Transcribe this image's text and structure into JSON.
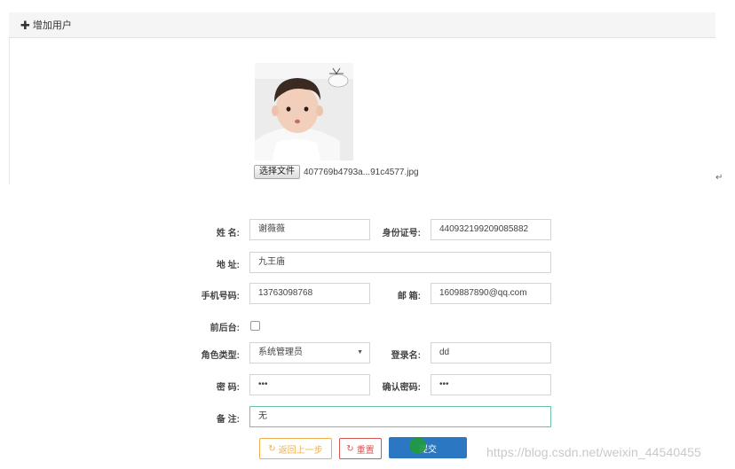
{
  "header": {
    "icon": "plus-icon",
    "title": "增加用户"
  },
  "upload": {
    "button_label": "选择文件",
    "file_name": "407769b4793a...91c4577.jpg"
  },
  "return_mark": "↵",
  "form": {
    "name": {
      "label": "姓 名:",
      "value": "谢薇薇"
    },
    "id_number": {
      "label": "身份证号:",
      "value": "440932199209085882"
    },
    "address": {
      "label": "地 址:",
      "value": "九王庙"
    },
    "phone": {
      "label": "手机号码:",
      "value": "13763098768"
    },
    "email": {
      "label": "邮 箱:",
      "value": "1609887890@qq.com"
    },
    "backend": {
      "label": "前后台:",
      "checked": false
    },
    "role": {
      "label": "角色类型:",
      "value": "系统管理员"
    },
    "login": {
      "label": "登录名:",
      "value": "dd"
    },
    "password": {
      "label": "密 码:",
      "value": "•••"
    },
    "confirm_password": {
      "label": "确认密码:",
      "value": "•••"
    },
    "remark": {
      "label": "备 注:",
      "value": "无"
    }
  },
  "buttons": {
    "back": {
      "icon": "refresh-icon",
      "label": "返回上一步"
    },
    "reset": {
      "icon": "refresh-icon",
      "label": "重置"
    },
    "submit": {
      "label": "提交"
    }
  },
  "watermark": "https://blog.csdn.net/weixin_44540455",
  "colors": {
    "back": "#f0ad4e",
    "reset": "#d9534f",
    "submit": "#2b77c2",
    "focus": "#6cc3a8"
  }
}
